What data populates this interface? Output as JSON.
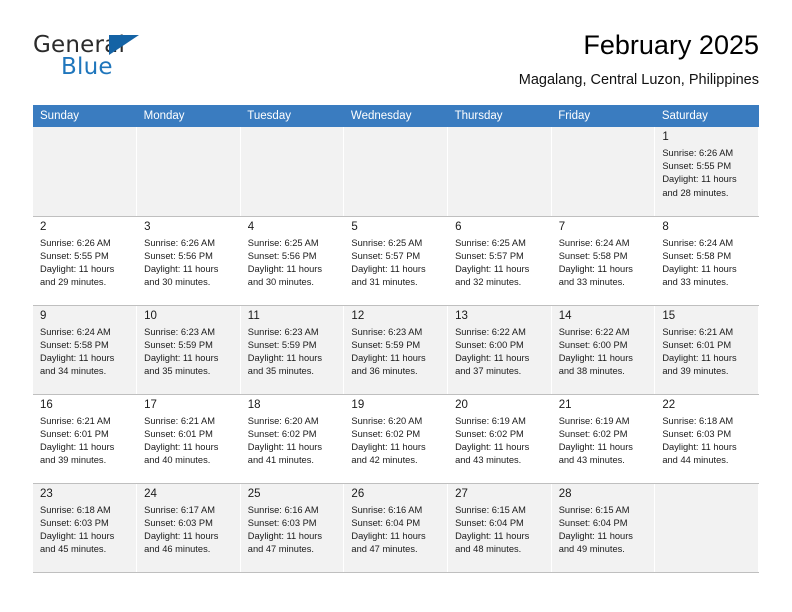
{
  "brand": {
    "name_part1": "General",
    "name_part2": "Blue",
    "logo_icon": "triangle-logo-icon"
  },
  "header": {
    "title": "February 2025",
    "subtitle": "Magalang, Central Luzon, Philippines"
  },
  "colors": {
    "header_bar": "#3a7cc0",
    "brand_blue": "#1f76bc",
    "row_shade": "#f2f2f2",
    "grid_line": "#bfbfbf"
  },
  "weekdays": [
    "Sunday",
    "Monday",
    "Tuesday",
    "Wednesday",
    "Thursday",
    "Friday",
    "Saturday"
  ],
  "weeks": [
    [
      {
        "empty": true
      },
      {
        "empty": true
      },
      {
        "empty": true
      },
      {
        "empty": true
      },
      {
        "empty": true
      },
      {
        "empty": true
      },
      {
        "day": "1",
        "sunrise": "Sunrise: 6:26 AM",
        "sunset": "Sunset: 5:55 PM",
        "daylight_line1": "Daylight: 11 hours",
        "daylight_line2": "and 28 minutes."
      }
    ],
    [
      {
        "day": "2",
        "sunrise": "Sunrise: 6:26 AM",
        "sunset": "Sunset: 5:55 PM",
        "daylight_line1": "Daylight: 11 hours",
        "daylight_line2": "and 29 minutes."
      },
      {
        "day": "3",
        "sunrise": "Sunrise: 6:26 AM",
        "sunset": "Sunset: 5:56 PM",
        "daylight_line1": "Daylight: 11 hours",
        "daylight_line2": "and 30 minutes."
      },
      {
        "day": "4",
        "sunrise": "Sunrise: 6:25 AM",
        "sunset": "Sunset: 5:56 PM",
        "daylight_line1": "Daylight: 11 hours",
        "daylight_line2": "and 30 minutes."
      },
      {
        "day": "5",
        "sunrise": "Sunrise: 6:25 AM",
        "sunset": "Sunset: 5:57 PM",
        "daylight_line1": "Daylight: 11 hours",
        "daylight_line2": "and 31 minutes."
      },
      {
        "day": "6",
        "sunrise": "Sunrise: 6:25 AM",
        "sunset": "Sunset: 5:57 PM",
        "daylight_line1": "Daylight: 11 hours",
        "daylight_line2": "and 32 minutes."
      },
      {
        "day": "7",
        "sunrise": "Sunrise: 6:24 AM",
        "sunset": "Sunset: 5:58 PM",
        "daylight_line1": "Daylight: 11 hours",
        "daylight_line2": "and 33 minutes."
      },
      {
        "day": "8",
        "sunrise": "Sunrise: 6:24 AM",
        "sunset": "Sunset: 5:58 PM",
        "daylight_line1": "Daylight: 11 hours",
        "daylight_line2": "and 33 minutes."
      }
    ],
    [
      {
        "day": "9",
        "sunrise": "Sunrise: 6:24 AM",
        "sunset": "Sunset: 5:58 PM",
        "daylight_line1": "Daylight: 11 hours",
        "daylight_line2": "and 34 minutes."
      },
      {
        "day": "10",
        "sunrise": "Sunrise: 6:23 AM",
        "sunset": "Sunset: 5:59 PM",
        "daylight_line1": "Daylight: 11 hours",
        "daylight_line2": "and 35 minutes."
      },
      {
        "day": "11",
        "sunrise": "Sunrise: 6:23 AM",
        "sunset": "Sunset: 5:59 PM",
        "daylight_line1": "Daylight: 11 hours",
        "daylight_line2": "and 35 minutes."
      },
      {
        "day": "12",
        "sunrise": "Sunrise: 6:23 AM",
        "sunset": "Sunset: 5:59 PM",
        "daylight_line1": "Daylight: 11 hours",
        "daylight_line2": "and 36 minutes."
      },
      {
        "day": "13",
        "sunrise": "Sunrise: 6:22 AM",
        "sunset": "Sunset: 6:00 PM",
        "daylight_line1": "Daylight: 11 hours",
        "daylight_line2": "and 37 minutes."
      },
      {
        "day": "14",
        "sunrise": "Sunrise: 6:22 AM",
        "sunset": "Sunset: 6:00 PM",
        "daylight_line1": "Daylight: 11 hours",
        "daylight_line2": "and 38 minutes."
      },
      {
        "day": "15",
        "sunrise": "Sunrise: 6:21 AM",
        "sunset": "Sunset: 6:01 PM",
        "daylight_line1": "Daylight: 11 hours",
        "daylight_line2": "and 39 minutes."
      }
    ],
    [
      {
        "day": "16",
        "sunrise": "Sunrise: 6:21 AM",
        "sunset": "Sunset: 6:01 PM",
        "daylight_line1": "Daylight: 11 hours",
        "daylight_line2": "and 39 minutes."
      },
      {
        "day": "17",
        "sunrise": "Sunrise: 6:21 AM",
        "sunset": "Sunset: 6:01 PM",
        "daylight_line1": "Daylight: 11 hours",
        "daylight_line2": "and 40 minutes."
      },
      {
        "day": "18",
        "sunrise": "Sunrise: 6:20 AM",
        "sunset": "Sunset: 6:02 PM",
        "daylight_line1": "Daylight: 11 hours",
        "daylight_line2": "and 41 minutes."
      },
      {
        "day": "19",
        "sunrise": "Sunrise: 6:20 AM",
        "sunset": "Sunset: 6:02 PM",
        "daylight_line1": "Daylight: 11 hours",
        "daylight_line2": "and 42 minutes."
      },
      {
        "day": "20",
        "sunrise": "Sunrise: 6:19 AM",
        "sunset": "Sunset: 6:02 PM",
        "daylight_line1": "Daylight: 11 hours",
        "daylight_line2": "and 43 minutes."
      },
      {
        "day": "21",
        "sunrise": "Sunrise: 6:19 AM",
        "sunset": "Sunset: 6:02 PM",
        "daylight_line1": "Daylight: 11 hours",
        "daylight_line2": "and 43 minutes."
      },
      {
        "day": "22",
        "sunrise": "Sunrise: 6:18 AM",
        "sunset": "Sunset: 6:03 PM",
        "daylight_line1": "Daylight: 11 hours",
        "daylight_line2": "and 44 minutes."
      }
    ],
    [
      {
        "day": "23",
        "sunrise": "Sunrise: 6:18 AM",
        "sunset": "Sunset: 6:03 PM",
        "daylight_line1": "Daylight: 11 hours",
        "daylight_line2": "and 45 minutes."
      },
      {
        "day": "24",
        "sunrise": "Sunrise: 6:17 AM",
        "sunset": "Sunset: 6:03 PM",
        "daylight_line1": "Daylight: 11 hours",
        "daylight_line2": "and 46 minutes."
      },
      {
        "day": "25",
        "sunrise": "Sunrise: 6:16 AM",
        "sunset": "Sunset: 6:03 PM",
        "daylight_line1": "Daylight: 11 hours",
        "daylight_line2": "and 47 minutes."
      },
      {
        "day": "26",
        "sunrise": "Sunrise: 6:16 AM",
        "sunset": "Sunset: 6:04 PM",
        "daylight_line1": "Daylight: 11 hours",
        "daylight_line2": "and 47 minutes."
      },
      {
        "day": "27",
        "sunrise": "Sunrise: 6:15 AM",
        "sunset": "Sunset: 6:04 PM",
        "daylight_line1": "Daylight: 11 hours",
        "daylight_line2": "and 48 minutes."
      },
      {
        "day": "28",
        "sunrise": "Sunrise: 6:15 AM",
        "sunset": "Sunset: 6:04 PM",
        "daylight_line1": "Daylight: 11 hours",
        "daylight_line2": "and 49 minutes."
      },
      {
        "empty": true
      }
    ]
  ]
}
